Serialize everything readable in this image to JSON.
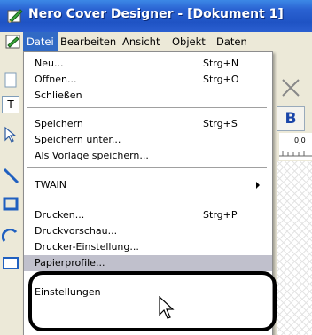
{
  "window": {
    "title": "Nero Cover Designer - [Dokument 1]"
  },
  "menubar": {
    "items": [
      "Datei",
      "Bearbeiten",
      "Ansicht",
      "Objekt",
      "Daten"
    ]
  },
  "toolbar": {
    "bold_label": "B",
    "ruler_label": "0,0"
  },
  "file_menu": {
    "items": [
      {
        "label": "Neu...",
        "shortcut": "Strg+N"
      },
      {
        "label": "Öffnen...",
        "shortcut": "Strg+O"
      },
      {
        "label": "Schließen",
        "shortcut": ""
      },
      {
        "label": "Speichern",
        "shortcut": "Strg+S"
      },
      {
        "label": "Speichern unter...",
        "shortcut": ""
      },
      {
        "label": "Als Vorlage speichern...",
        "shortcut": ""
      },
      {
        "label": "TWAIN",
        "shortcut": ""
      },
      {
        "label": "Drucken...",
        "shortcut": "Strg+P"
      },
      {
        "label": "Druckvorschau...",
        "shortcut": ""
      },
      {
        "label": "Drucker-Einstellung...",
        "shortcut": ""
      },
      {
        "label": "Papierprofile...",
        "shortcut": ""
      },
      {
        "label": "Einstellungen",
        "shortcut": ""
      }
    ]
  },
  "colors": {
    "titlebar": "#1f53c4",
    "menu_active": "#316ac5",
    "highlight": "#c0c0cc"
  }
}
